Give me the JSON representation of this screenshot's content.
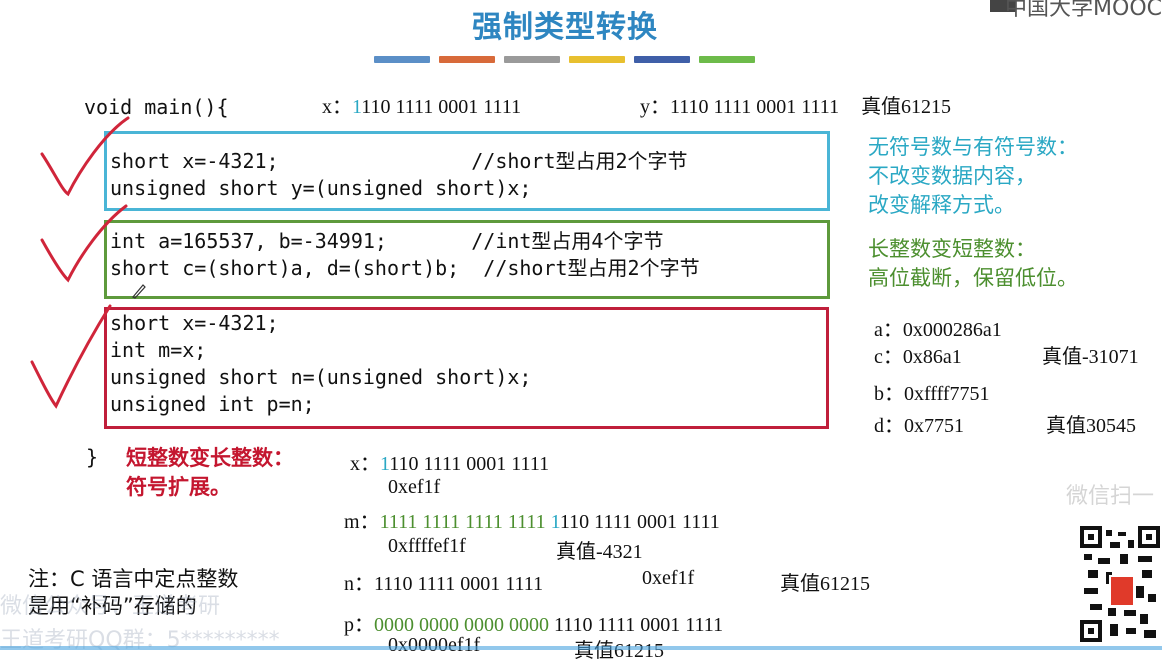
{
  "header": {
    "title": "强制类型转换",
    "logo_text": "中国大学MOOC",
    "color_segments": [
      "#5b8fc7",
      "#d86a3a",
      "#9a9a9a",
      "#e8c02f",
      "#3f5fa8",
      "#6dbb4a"
    ]
  },
  "code": {
    "main_open": "void main(){",
    "main_close": "}",
    "box1": [
      "short x=-4321;                //short型占用2个字节",
      "unsigned short y=(unsigned short)x;"
    ],
    "box2": [
      "int a=165537, b=-34991;       //int型占用4个字节",
      "short c=(short)a, d=(short)b;  //short型占用2个字节"
    ],
    "box3": [
      "short x=-4321;",
      "int m=x;",
      "unsigned short n=(unsigned short)x;",
      "unsigned int p=n;"
    ]
  },
  "top_values": {
    "x_label": "x：",
    "x_first_bit": "1",
    "x_rest": "110 1111 0001 1111",
    "y_label": "y：",
    "y_bits": "1110 1111 0001 1111",
    "y_true": "真值61215"
  },
  "notes": {
    "unsigned_signed": [
      "无符号数与有符号数：",
      "不改变数据内容，",
      "改变解释方式。"
    ],
    "long_to_short": [
      "长整数变短整数：",
      "高位截断，保留低位。"
    ],
    "short_to_long": [
      "短整数变长整数：",
      "符号扩展。"
    ],
    "storage": [
      "注：C 语言中定点整数",
      "是用“补码”存储的"
    ]
  },
  "right_values": {
    "a": "a：0x000286a1",
    "c": "c：0x86a1",
    "c_true": "真值-31071",
    "b": "b：0xffff7751",
    "d": "d：0x7751",
    "d_true": "真值30545"
  },
  "bottom_values": {
    "x_label": "x：",
    "x_first_bit": "1",
    "x_rest": "110 1111 0001 1111",
    "x_hex": "0xef1f",
    "m_label": "m：",
    "m_ext": "1111 1111 1111 1111",
    "m_first_bit": "1",
    "m_rest": "110 1111 0001 1111",
    "m_hex": "0xffffef1f",
    "m_true": "真值-4321",
    "n_label": "n：",
    "n_bits": "1110 1111 0001 1111",
    "n_hex": "0xef1f",
    "n_true": "真值61215",
    "p_label": "p：",
    "p_ext": "0000 0000 0000 0000",
    "p_rest": "1110 1111 0001 1111",
    "p_hex": "0x0000ef1f",
    "p_true": "真值61215"
  },
  "watermarks": {
    "wechat": "微信扫一",
    "line1": "微信公众号：王道考研",
    "line2": "王道考研QQ群：5*********"
  }
}
